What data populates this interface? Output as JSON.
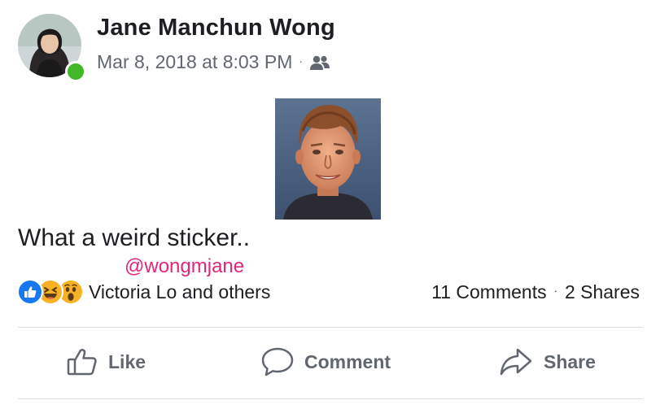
{
  "post": {
    "author": "Jane Manchun Wong",
    "timestamp": "Mar 8, 2018 at 8:03 PM",
    "audience_separator": "·",
    "audience_icon": "friends-icon",
    "text": "What a weird sticker..",
    "watermark": "@wongmjane"
  },
  "reactions": {
    "icons": [
      "like-reaction-icon",
      "haha-reaction-icon",
      "wow-reaction-icon"
    ],
    "names": "Victoria Lo and others"
  },
  "counts": {
    "comments": "11 Comments",
    "separator": "·",
    "shares": "2 Shares"
  },
  "actions": {
    "like": "Like",
    "comment": "Comment",
    "share": "Share"
  },
  "colors": {
    "online": "#42b72a",
    "like_blue": "#1877f2",
    "reaction_yellow": "#f7b125",
    "watermark_pink": "#e0267b",
    "secondary_text": "#606770"
  }
}
